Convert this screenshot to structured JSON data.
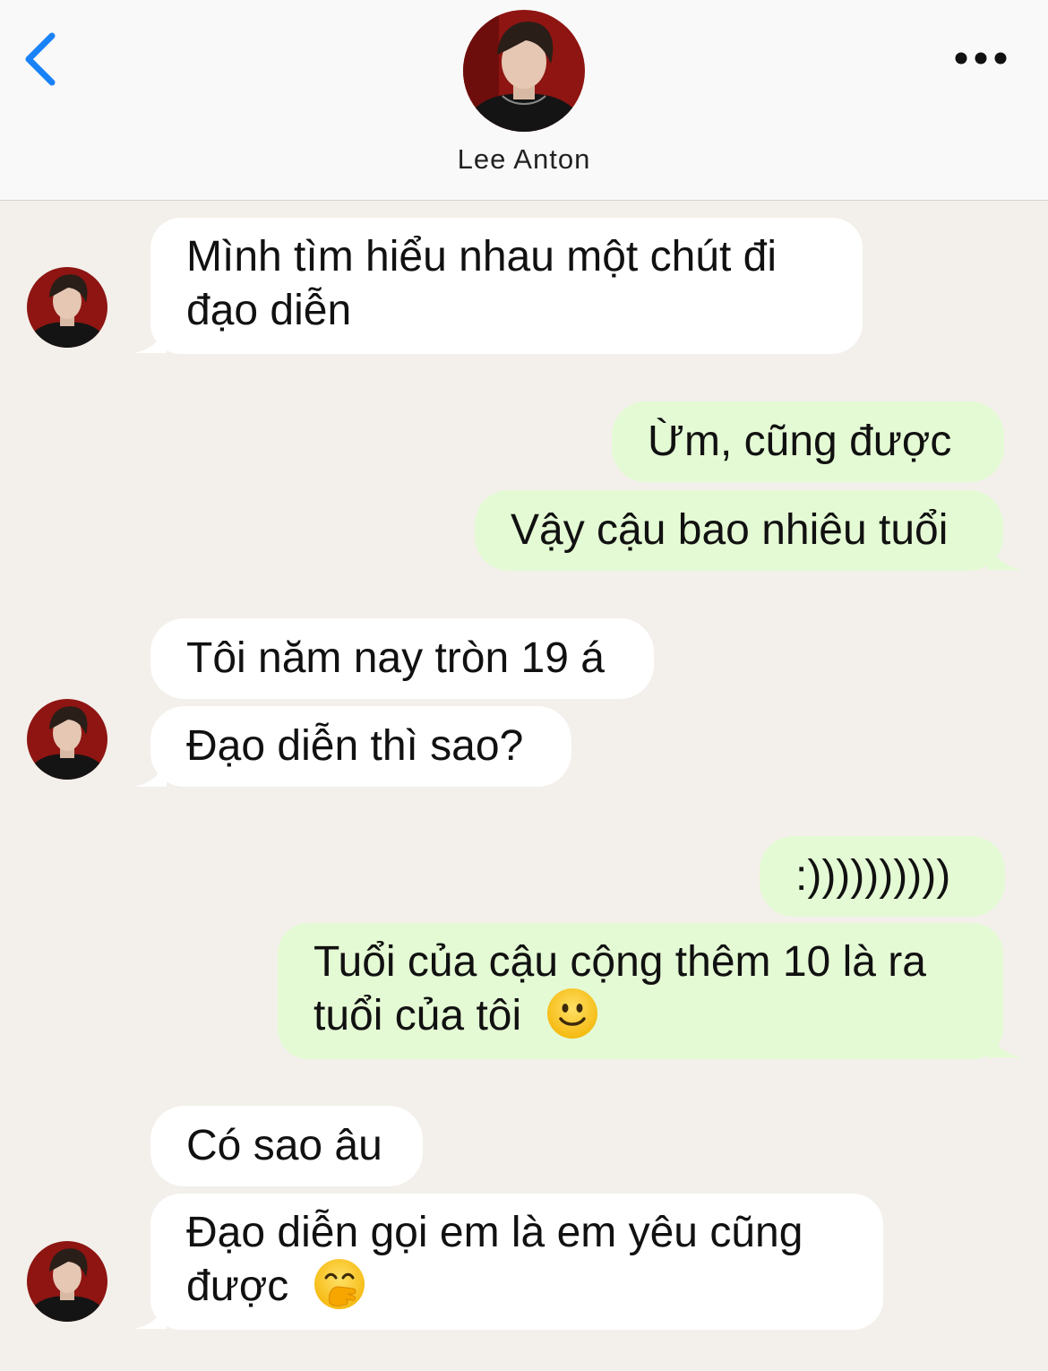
{
  "header": {
    "contact_name": "Lee Anton",
    "back_icon": "chevron-left-icon",
    "more_icon": "ellipsis-icon",
    "accent_color": "#1a82f7"
  },
  "colors": {
    "incoming_bubble": "#ffffff",
    "outgoing_bubble": "#e4fad4",
    "background": "#f3f0eb"
  },
  "messages": [
    {
      "sender": "contact",
      "lines": [
        "Mình tìm hiểu nhau một chút đi",
        "đạo diễn"
      ]
    },
    {
      "sender": "me",
      "lines": [
        "Ừm, cũng được"
      ]
    },
    {
      "sender": "me",
      "lines": [
        "Vậy cậu bao nhiêu tuổi"
      ]
    },
    {
      "sender": "contact",
      "lines": [
        "Tôi năm nay tròn 19 á"
      ]
    },
    {
      "sender": "contact",
      "lines": [
        "Đạo diễn thì sao?"
      ]
    },
    {
      "sender": "me",
      "lines": [
        ":))))))))))"
      ]
    },
    {
      "sender": "me",
      "lines": [
        "Tuổi của cậu cộng thêm 10 là ra",
        "tuổi của tôi"
      ],
      "emoji": "slightly-smiling-face"
    },
    {
      "sender": "contact",
      "lines": [
        "Có sao âu"
      ]
    },
    {
      "sender": "contact",
      "lines": [
        "Đạo diễn gọi em là em yêu cũng",
        "được"
      ],
      "emoji": "face-with-hand-over-mouth"
    }
  ]
}
